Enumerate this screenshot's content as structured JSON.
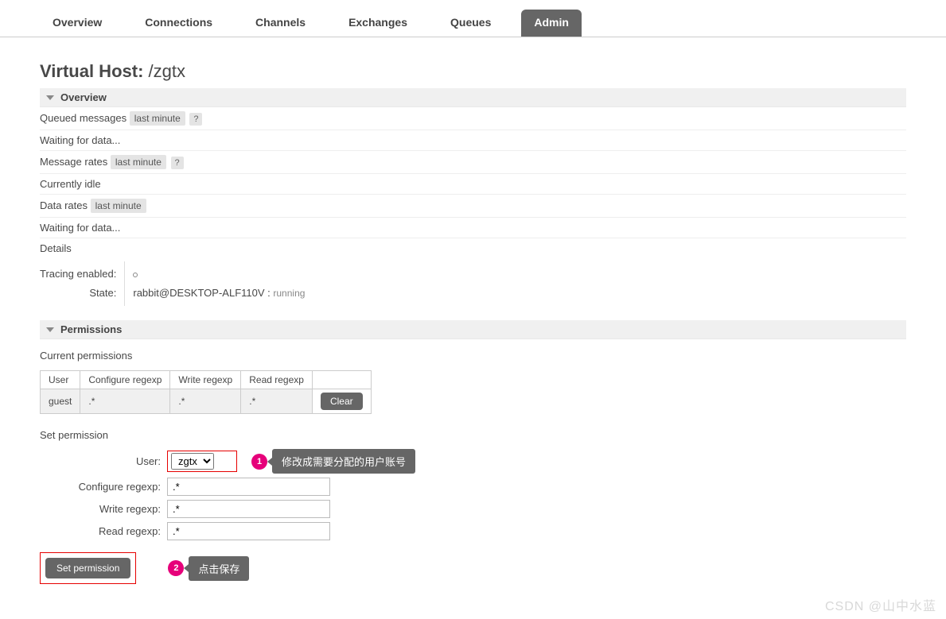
{
  "nav": {
    "tabs": [
      "Overview",
      "Connections",
      "Channels",
      "Exchanges",
      "Queues",
      "Admin"
    ],
    "active": "Admin"
  },
  "title": {
    "prefix": "Virtual Host: ",
    "path": "/zgtx"
  },
  "sections": {
    "overview": {
      "header": "Overview",
      "queued_label": "Queued messages",
      "queued_period": "last minute",
      "waiting1": "Waiting for data...",
      "msgrates_label": "Message rates",
      "msgrates_period": "last minute",
      "idle": "Currently idle",
      "datarates_label": "Data rates",
      "datarates_period": "last minute",
      "waiting2": "Waiting for data...",
      "details_label": "Details",
      "details": {
        "tracing_label": "Tracing enabled:",
        "state_label": "State:",
        "state_value": "rabbit@DESKTOP-ALF110V :",
        "state_status": "running"
      }
    },
    "permissions": {
      "header": "Permissions",
      "current_label": "Current permissions",
      "table": {
        "cols": [
          "User",
          "Configure regexp",
          "Write regexp",
          "Read regexp"
        ],
        "row": {
          "user": "guest",
          "configure": ".*",
          "write": ".*",
          "read": ".*"
        },
        "clear": "Clear"
      },
      "set_label": "Set permission",
      "form": {
        "user_label": "User:",
        "user_value": "zgtx",
        "configure_label": "Configure regexp:",
        "configure_value": ".*",
        "write_label": "Write regexp:",
        "write_value": ".*",
        "read_label": "Read regexp:",
        "read_value": ".*",
        "submit": "Set permission"
      }
    }
  },
  "annotations": {
    "a1": {
      "num": "1",
      "text": "修改成需要分配的用户账号"
    },
    "a2": {
      "num": "2",
      "text": "点击保存"
    }
  },
  "watermark": "CSDN @山中水蓝"
}
